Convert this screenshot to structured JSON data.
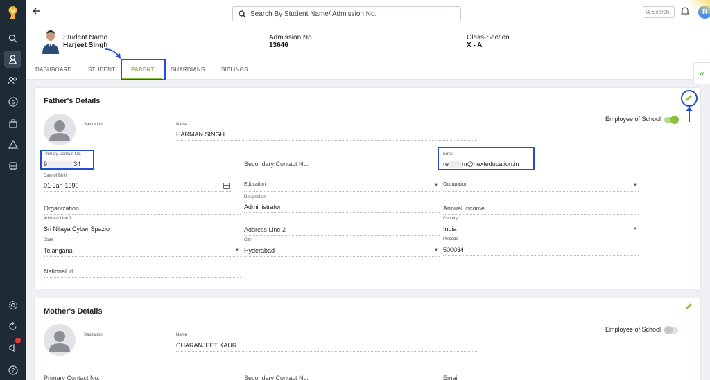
{
  "topbar": {
    "search_placeholder": "Search By Student Name/ Admission No.",
    "small_search_placeholder": "Search",
    "avatar_initial": "R"
  },
  "student": {
    "name_label": "Student Name",
    "name_value": "Harjeet Singh",
    "admission_label": "Admission No.",
    "admission_value": "13646",
    "class_label": "Class-Section",
    "class_value": "X - A"
  },
  "tabs": [
    {
      "label": "DASHBOARD",
      "active": false
    },
    {
      "label": "STUDENT",
      "active": false
    },
    {
      "label": "PARENT",
      "active": true
    },
    {
      "label": "GUARDIANS",
      "active": false
    },
    {
      "label": "SIBLINGS",
      "active": false
    }
  ],
  "father": {
    "title": "Father's Details",
    "salutation_label": "Salutation",
    "name_label": "Name",
    "name_value": "HARMAN SINGH",
    "employee_label": "Employee of School",
    "employee_toggle": true,
    "primary_contact_label": "Primary Contact No.",
    "primary_contact_prefix": "9",
    "primary_contact_hidden": "▒▒▒▒▒▒",
    "primary_contact_suffix": "34",
    "secondary_contact_placeholder": "Secondary Contact No.",
    "email_label": "Email",
    "email_prefix": "re",
    "email_hidden": "▒▒▒",
    "email_suffix": "m@nexteducation.in",
    "dob_label": "Date of Birth",
    "dob_value": "01-Jan-1990",
    "education_label": "Education",
    "occupation_label": "Occupation",
    "organization_placeholder": "Organization",
    "designation_label": "Designation",
    "designation_value": "Administrator",
    "annual_income_placeholder": "Annual Income",
    "address1_label": "Address Line 1",
    "address1_value": "Sri Nilaya Cyber Spazio",
    "address2_placeholder": "Address Line 2",
    "country_label": "Country",
    "country_value": "India",
    "state_label": "State",
    "state_value": "Telangana",
    "city_label": "City",
    "city_value": "Hyderabad",
    "pincode_label": "Pincode",
    "pincode_value": "500034",
    "national_id_placeholder": "National Id"
  },
  "mother": {
    "title": "Mother's Details",
    "salutation_label": "Salutation",
    "name_label": "Name",
    "name_value": "CHARANJEET KAUR",
    "employee_label": "Employee of School",
    "employee_toggle": false,
    "primary_contact_placeholder": "Primary Contact No.",
    "secondary_contact_placeholder": "Secondary Contact No.",
    "email_placeholder": "Email"
  },
  "colors": {
    "accent_green": "#8bbf3f",
    "sidebar_bg": "#1f2a37",
    "annotation_blue": "#1f4fd1"
  },
  "icons": {
    "sidebar": [
      "search-icon",
      "student-icon",
      "users-icon",
      "dollar-icon",
      "building-icon",
      "bell-icon",
      "bus-icon",
      "settings-icon",
      "refresh-icon",
      "megaphone-icon",
      "help-icon"
    ]
  }
}
